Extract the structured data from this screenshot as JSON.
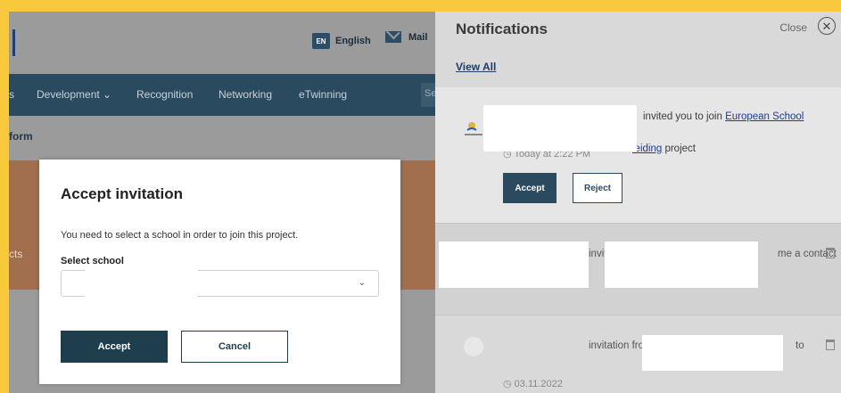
{
  "site": {
    "lang_code": "EN",
    "lang_label": "English",
    "mail_label": "Mail",
    "nav": [
      "s",
      "Development ⌄",
      "Recognition",
      "Networking",
      "eTwinning"
    ],
    "search_stub": "Se",
    "sub_title": "form",
    "side_text": "cts"
  },
  "modal": {
    "title": "Accept invitation",
    "message": "You need to select a school in order to join this project.",
    "select_label": "Select school",
    "select_value": "",
    "accept_label": "Accept",
    "cancel_label": "Cancel"
  },
  "notifications": {
    "title": "Notifications",
    "close_label": "Close",
    "view_all": "View All",
    "items": [
      {
        "text_prefix": "invited you to join",
        "link1": "European School Education",
        "link2": "leiding",
        "text_suffix": "project",
        "time": "Today at 2:22 PM",
        "accept_label": "Accept",
        "reject_label": "Reject"
      },
      {
        "text_a": "invit",
        "text_b": "me a contact"
      },
      {
        "text_a": "invitation fro",
        "text_b": "to",
        "time": "03.11.2022"
      }
    ]
  }
}
